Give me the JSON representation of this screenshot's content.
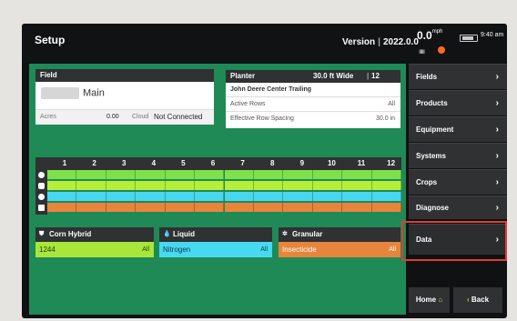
{
  "header": {
    "title": "Setup",
    "version_label": "Version",
    "version_number": "2022.0.0",
    "speed_value": "0.0",
    "speed_unit": "mph",
    "clock": "9:40 am"
  },
  "field": {
    "header": "Field",
    "name": "Main",
    "acres_label": "Acres",
    "acres_value": "0.00",
    "cloud_label": "Cloud",
    "cloud_status": "Not Connected"
  },
  "planter": {
    "header": "Planter",
    "width": "30.0 ft Wide",
    "rows": "12 Rows",
    "name": "John Deere Center Trailing",
    "active_rows_label": "Active Rows",
    "active_rows_value": "All",
    "row_spacing_label": "Effective Row Spacing",
    "row_spacing_value": "30.0 in"
  },
  "row_grid": {
    "row_numbers": [
      "1",
      "2",
      "3",
      "4",
      "5",
      "6",
      "7",
      "8",
      "9",
      "10",
      "11",
      "12"
    ],
    "bar_colors": [
      "#7ee04a",
      "#b6ee3b",
      "#49d6ef",
      "#e8853b"
    ]
  },
  "products": [
    {
      "header": "Corn Hybrid",
      "icon": "seed-icon",
      "value": "1244",
      "scope": "All",
      "color": "#a8e63a",
      "text_color": "#1b3a12"
    },
    {
      "header": "Liquid",
      "icon": "droplet-icon",
      "value": "Nitrogen",
      "scope": "All",
      "color": "#47d9f0",
      "text_color": "#0c3b46"
    },
    {
      "header": "Granular",
      "icon": "granular-icon",
      "value": "Insecticide",
      "scope": "All",
      "color": "#e6853b",
      "text_color": "#ffffff"
    }
  ],
  "sidebar": {
    "items": [
      {
        "label": "Fields"
      },
      {
        "label": "Products"
      },
      {
        "label": "Equipment"
      },
      {
        "label": "Systems"
      },
      {
        "label": "Crops"
      },
      {
        "label": "Diagnose"
      },
      {
        "label": "Data"
      }
    ],
    "home_label": "Home",
    "back_label": "Back"
  }
}
